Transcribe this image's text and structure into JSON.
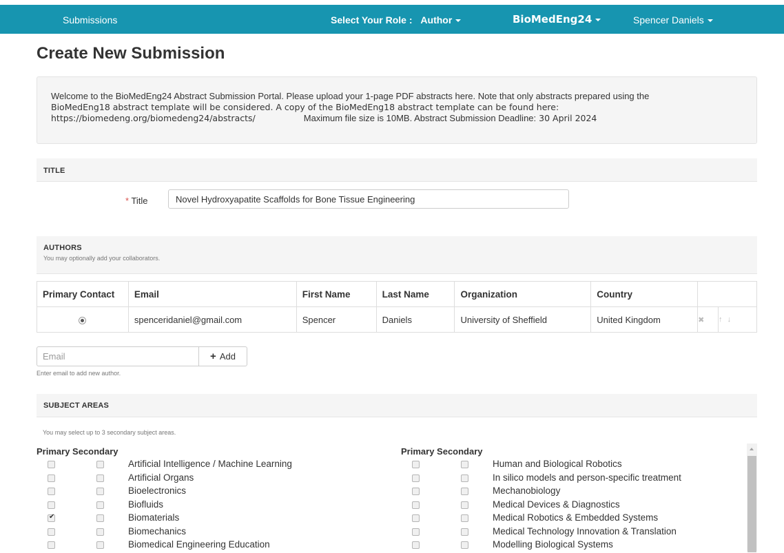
{
  "navbar": {
    "submissions": "Submissions",
    "role_label": "Select Your Role :",
    "role_value": "Author",
    "conference": "BioMedEng24",
    "user": "Spencer Daniels"
  },
  "page_title": "Create New Submission",
  "welcome": {
    "line1": "Welcome to the BioMedEng24 Abstract Submission Portal. Please upload your 1-page PDF abstracts here. Note that only abstracts prepared using the",
    "line2": "BioMedEng18 abstract template will be considered. A copy of the BioMedEng18 abstract template can be found here:",
    "url": "https://biomedeng.org/biomedeng24/abstracts/",
    "size_deadline": "Maximum file size is 10MB. Abstract Submission Deadline:",
    "deadline": "30 April 2024"
  },
  "title_section": {
    "header": "TITLE",
    "required_mark": "*",
    "label": "Title",
    "value": "Novel Hydroxyapatite Scaffolds for Bone Tissue Engineering"
  },
  "authors_section": {
    "header": "AUTHORS",
    "subtext": "You may optionally add your collaborators.",
    "columns": [
      "Primary Contact",
      "Email",
      "First Name",
      "Last Name",
      "Organization",
      "Country"
    ],
    "rows": [
      {
        "email": "spenceridaniel@gmail.com",
        "first": "Spencer",
        "last": "Daniels",
        "org": "University of Sheffield",
        "country": "United Kingdom"
      }
    ],
    "remove_icon": "✖",
    "up_icon": "↑",
    "down_icon": "↓",
    "add_placeholder": "Email",
    "add_plus": "+",
    "add_label": "Add",
    "help": "Enter email to add new author."
  },
  "subjects_section": {
    "header": "SUBJECT AREAS",
    "help": "You may select up to 3 secondary subject areas.",
    "primary_label": "Primary",
    "secondary_label": "Secondary",
    "left": [
      {
        "label": "Artificial Intelligence / Machine Learning",
        "primary": false
      },
      {
        "label": "Artificial Organs",
        "primary": false
      },
      {
        "label": "Bioelectronics",
        "primary": false
      },
      {
        "label": "Biofluids",
        "primary": false
      },
      {
        "label": "Biomaterials",
        "primary": true
      },
      {
        "label": "Biomechanics",
        "primary": false
      },
      {
        "label": "Biomedical Engineering Education",
        "primary": false
      }
    ],
    "right": [
      {
        "label": "Human and Biological Robotics",
        "primary": false
      },
      {
        "label": "In silico models and person-specific treatment",
        "primary": false
      },
      {
        "label": "Mechanobiology",
        "primary": false
      },
      {
        "label": "Medical Devices & Diagnostics",
        "primary": false
      },
      {
        "label": "Medical Robotics & Embedded Systems",
        "primary": false
      },
      {
        "label": "Medical Technology Innovation & Translation",
        "primary": false
      },
      {
        "label": "Modelling Biological Systems",
        "primary": false
      }
    ]
  },
  "colors": {
    "navbar": "#1795b0",
    "required": "#d9534f"
  }
}
